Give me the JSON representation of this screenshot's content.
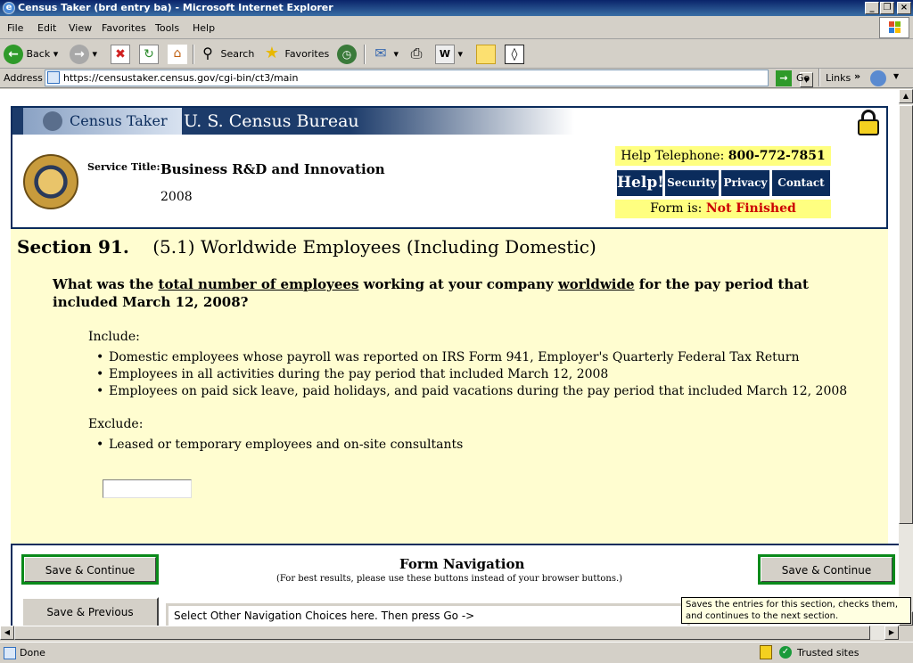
{
  "window": {
    "title": "Census Taker (brd entry ba) - Microsoft Internet Explorer",
    "buttons": [
      "_",
      "❐",
      "×"
    ]
  },
  "menu": [
    "File",
    "Edit",
    "View",
    "Favorites",
    "Tools",
    "Help"
  ],
  "toolbar": {
    "back": "Back",
    "search": "Search",
    "favorites": "Favorites"
  },
  "address": {
    "label": "Address",
    "url": "https://censustaker.census.gov/cgi-bin/ct3/main",
    "go": "Go",
    "links": "Links"
  },
  "banner": {
    "app_name": "Census Taker",
    "agency": "U. S. Census Bureau",
    "service_label": "Service Title:",
    "service_title": "Business R&D and Innovation",
    "year": "2008",
    "help_label": "Help Telephone:",
    "help_phone": "800-772-7851",
    "nav": [
      "Help!",
      "Security",
      "Privacy",
      "Contact Us"
    ],
    "form_status_label": "Form is:",
    "form_status": "Not Finished"
  },
  "section": {
    "number": "Section 91.",
    "title": "(5.1) Worldwide Employees (Including Domestic)",
    "question_parts": [
      "What was the ",
      "total number of employees",
      " working at your company ",
      "worldwide",
      " for the pay period that included March 12, 2008?"
    ],
    "include_label": "Include:",
    "include_items": [
      "Domestic employees whose payroll was reported on IRS Form 941, Employer's Quarterly Federal Tax Return",
      "Employees in all activities during the pay period that included March 12, 2008",
      "Employees on paid sick leave, paid holidays, and paid vacations during the pay period that included March 12, 2008"
    ],
    "exclude_label": "Exclude:",
    "exclude_items": [
      "Leased or temporary employees and on-site consultants"
    ],
    "answer_value": ""
  },
  "form_nav": {
    "title": "Form Navigation",
    "subtitle": "(For best results, please use these buttons instead of your browser buttons.)",
    "save_continue": "Save & Continue",
    "save_previous": "Save & Previous",
    "select_text": "Select Other Navigation Choices here. Then press Go ->",
    "tooltip": "Saves the entries for this section, checks them, and continues to the next section."
  },
  "status": {
    "left": "Done",
    "zone": "Trusted sites"
  },
  "colors": {
    "banner_blue": "#0b2c5c",
    "section_bg": "#fffdd0",
    "highlight_yellow": "#ffff80",
    "status_red": "#cc0000",
    "button_green": "#0a8a1a"
  }
}
